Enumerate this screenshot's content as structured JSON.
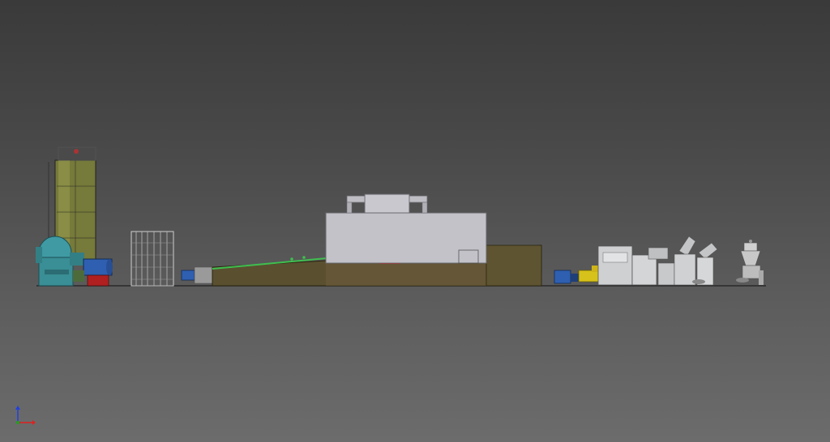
{
  "viewport": {
    "background_top": "#3a3a3a",
    "background_bottom": "#6c6c6c"
  },
  "scene": {
    "description_icon": "factory-production-line-side-view",
    "colors": {
      "silo": "#7a8040",
      "tank": "#3f9aa3",
      "burner_blue": "#2f5fb0",
      "burner_red": "#b02020",
      "oven_body": "#5a5030",
      "hood": "#c2c2c8",
      "conveyor_green": "#3fbf4f",
      "yellow_unit": "#d6c21a",
      "machine_grey": "#cfd0d2"
    }
  },
  "triad": {
    "axis_x_color": "#e02020",
    "axis_y_color": "#20a020",
    "axis_z_color": "#2040e0"
  }
}
